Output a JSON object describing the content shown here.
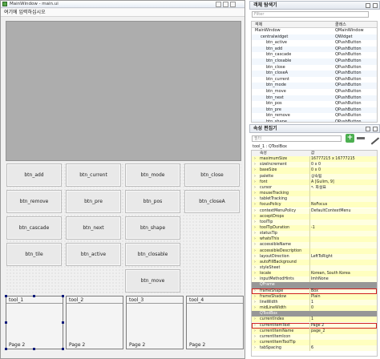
{
  "form": {
    "title": "MainWindow - main.ui",
    "menu_placeholder": "여기에 입력하십시오",
    "buttons": [
      "btn_add",
      "btn_current",
      "btn_mode",
      "btn_close",
      "btn_remove",
      "btn_pre",
      "btn_pos",
      "btn_closeA",
      "btn_cascade",
      "btn_next",
      "btn_shape",
      "btn_tile",
      "btn_active",
      "btn_closable",
      "btn_move"
    ],
    "toolbox": [
      {
        "title": "tool_1",
        "page": "Page 2"
      },
      {
        "title": "tool_2",
        "page": "Page 2"
      },
      {
        "title": "tool_3",
        "page": "Page 2"
      },
      {
        "title": "tool_4",
        "page": "Page 2"
      }
    ]
  },
  "object_inspector": {
    "title": "객체 탐색기",
    "filter": "Filter",
    "header": {
      "object": "객체",
      "class": "클래스"
    },
    "rows": [
      {
        "object": "MainWindow",
        "class": "QMainWindow",
        "indent": 0
      },
      {
        "object": "centralwidget",
        "class": "QWidget",
        "indent": 1
      },
      {
        "object": "btn_active",
        "class": "QPushButton",
        "indent": 2
      },
      {
        "object": "btn_add",
        "class": "QPushButton",
        "indent": 2
      },
      {
        "object": "btn_cascade",
        "class": "QPushButton",
        "indent": 2
      },
      {
        "object": "btn_closable",
        "class": "QPushButton",
        "indent": 2
      },
      {
        "object": "btn_close",
        "class": "QPushButton",
        "indent": 2
      },
      {
        "object": "btn_closeA",
        "class": "QPushButton",
        "indent": 2
      },
      {
        "object": "btn_current",
        "class": "QPushButton",
        "indent": 2
      },
      {
        "object": "btn_mode",
        "class": "QPushButton",
        "indent": 2
      },
      {
        "object": "btn_move",
        "class": "QPushButton",
        "indent": 2
      },
      {
        "object": "btn_next",
        "class": "QPushButton",
        "indent": 2
      },
      {
        "object": "btn_pos",
        "class": "QPushButton",
        "indent": 2
      },
      {
        "object": "btn_pre",
        "class": "QPushButton",
        "indent": 2
      },
      {
        "object": "btn_remove",
        "class": "QPushButton",
        "indent": 2
      },
      {
        "object": "btn_shape",
        "class": "QPushButton",
        "indent": 2
      },
      {
        "object": "btn_tile",
        "class": "QPushButton",
        "indent": 2
      },
      {
        "object": "mdi",
        "class": "QMdiArea",
        "indent": 2
      },
      {
        "object": "tool_1",
        "class": "QToolBox",
        "indent": 2
      }
    ]
  },
  "property_editor": {
    "title": "속성 편집기",
    "filter": "필터",
    "breadcrumb": "tool_1 : QToolBox",
    "header": {
      "property": "속성",
      "value": "값"
    },
    "rows": [
      {
        "name": "maximumSize",
        "value": "16777215 x 16777215",
        "type": "prop"
      },
      {
        "name": "sizeIncrement",
        "value": "0 x 0",
        "type": "prop"
      },
      {
        "name": "baseSize",
        "value": "0 x 0",
        "type": "prop"
      },
      {
        "name": "palette",
        "value": "상속됨",
        "type": "prop"
      },
      {
        "name": "font",
        "value": "A  [Gulim, 9]",
        "type": "prop"
      },
      {
        "name": "cursor",
        "value": "↖ 화살표",
        "type": "prop"
      },
      {
        "name": "mouseTracking",
        "value": "",
        "type": "prop"
      },
      {
        "name": "tabletTracking",
        "value": "",
        "type": "prop"
      },
      {
        "name": "focusPolicy",
        "value": "NoFocus",
        "type": "prop"
      },
      {
        "name": "contextMenuPolicy",
        "value": "DefaultContextMenu",
        "type": "prop"
      },
      {
        "name": "acceptDrops",
        "value": "",
        "type": "prop"
      },
      {
        "name": "toolTip",
        "value": "",
        "type": "prop"
      },
      {
        "name": "toolTipDuration",
        "value": "-1",
        "type": "prop"
      },
      {
        "name": "statusTip",
        "value": "",
        "type": "prop"
      },
      {
        "name": "whatsThis",
        "value": "",
        "type": "prop"
      },
      {
        "name": "accessibleName",
        "value": "",
        "type": "prop"
      },
      {
        "name": "accessibleDescription",
        "value": "",
        "type": "prop"
      },
      {
        "name": "layoutDirection",
        "value": "LeftToRight",
        "type": "prop"
      },
      {
        "name": "autoFillBackground",
        "value": "",
        "type": "prop"
      },
      {
        "name": "styleSheet",
        "value": "",
        "type": "prop"
      },
      {
        "name": "locale",
        "value": "Korean, South Korea",
        "type": "prop"
      },
      {
        "name": "inputMethodHints",
        "value": "ImhNone",
        "type": "prop"
      },
      {
        "name": "QFrame",
        "value": "",
        "type": "group"
      },
      {
        "name": "frameShape",
        "value": "Box",
        "type": "prop",
        "highlight": true
      },
      {
        "name": "frameShadow",
        "value": "Plain",
        "type": "prop"
      },
      {
        "name": "lineWidth",
        "value": "1",
        "type": "prop"
      },
      {
        "name": "midLineWidth",
        "value": "0",
        "type": "prop"
      },
      {
        "name": "QToolBox",
        "value": "",
        "type": "group"
      },
      {
        "name": "currentIndex",
        "value": "1",
        "type": "prop"
      },
      {
        "name": "currentItemText",
        "value": "Page 2",
        "type": "prop",
        "highlight": true
      },
      {
        "name": "currentItemName",
        "value": "page_2",
        "type": "prop"
      },
      {
        "name": "currentItemIcon",
        "value": "",
        "type": "prop"
      },
      {
        "name": "currentItemToolTip",
        "value": "",
        "type": "prop"
      },
      {
        "name": "tabSpacing",
        "value": "6",
        "type": "prop"
      }
    ]
  },
  "colors": {
    "property_yellow": "#ffffbf",
    "group_gray": "#979797",
    "highlight_red": "#d01f1f",
    "selection_blue": "#0d1a7a"
  }
}
